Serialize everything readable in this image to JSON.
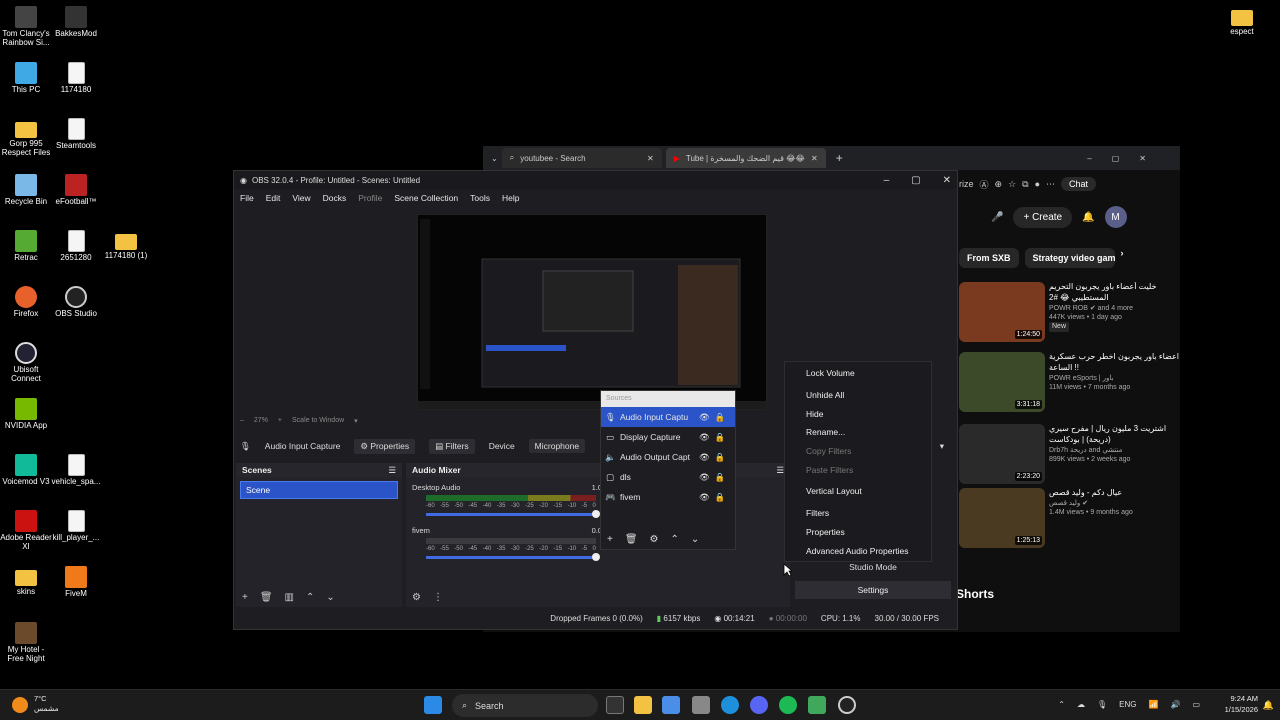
{
  "desktop": {
    "icons": [
      {
        "label": "Tom Clancy's Rainbow Si..."
      },
      {
        "label": "BakkesMod"
      },
      {
        "label": "This PC"
      },
      {
        "label": "1174180"
      },
      {
        "label": "Gorp 995 Respect Files"
      },
      {
        "label": "Steamtools"
      },
      {
        "label": "Recycle Bin"
      },
      {
        "label": "eFootball™"
      },
      {
        "label": "Retrac"
      },
      {
        "label": "2651280"
      },
      {
        "label": "1174180 (1)"
      },
      {
        "label": "Firefox"
      },
      {
        "label": "OBS Studio"
      },
      {
        "label": "Ubisoft Connect"
      },
      {
        "label": "NVIDIA App"
      },
      {
        "label": "Voicemod V3"
      },
      {
        "label": "vehicle_spa..."
      },
      {
        "label": "Adobe Reader XI"
      },
      {
        "label": "kill_player_..."
      },
      {
        "label": "skins"
      },
      {
        "label": "FiveM"
      },
      {
        "label": "My Hotel - Free Night"
      },
      {
        "label": "espect"
      }
    ]
  },
  "browser": {
    "tab1": "youtubee - Search",
    "tab2": "Tube | قيم الضحك والمسخرة 😂😂",
    "toolbar_partial": "rize",
    "chat_label": "Chat",
    "create_label": "Create",
    "avatar_letter": "M",
    "chips": [
      "From SXB",
      "Strategy video gam"
    ],
    "videos": [
      {
        "title": "خليت أعضاء باور يجربون التحريم المستطيبي 😂 #2",
        "channel": "POWR ROB ✔ and 4 more",
        "stats": "447K views • 1 day ago",
        "badge": "New",
        "duration": "1:24:50"
      },
      {
        "title": "اعضاء باور يجربون اخطر حرب عسكرية !! الساعة",
        "channel": "POWR eSports | باور",
        "stats": "11M views • 7 months ago",
        "badge": "",
        "duration": "3:31:18"
      },
      {
        "title": "اشتريت 3 مليون ريال | مفرح سيري (دريحة) | بودكاست",
        "channel": "Drb7h دريحة and منتشي",
        "stats": "899K views • 2 weeks ago",
        "badge": "",
        "duration": "2:23:20"
      },
      {
        "title": "عيال دكم - وليد قصص",
        "channel": "وليد قصص ✔",
        "stats": "1.4M views • 9 months ago",
        "badge": "",
        "duration": "1:25:13"
      }
    ],
    "shorts_label": "Shorts"
  },
  "obs": {
    "title": "OBS 32.0.4 - Profile: Untitled - Scenes: Untitled",
    "menu": [
      "File",
      "Edit",
      "View",
      "Docks",
      "Profile",
      "Scene Collection",
      "Tools",
      "Help"
    ],
    "zoom": "27%",
    "scale_label": "Scale to Window",
    "context_source": "Audio Input Capture",
    "properties_label": "Properties",
    "filters_label": "Filters",
    "device_label": "Device",
    "device_value": "Microphone",
    "scenes_header": "Scenes",
    "scenes": [
      "Scene"
    ],
    "mixer_header": "Audio Mixer",
    "channels": [
      {
        "name": "Desktop Audio",
        "db": "1.0"
      },
      {
        "name": "fivem",
        "db": "0.0"
      }
    ],
    "scale_ticks": [
      "-60",
      "-55",
      "-50",
      "-45",
      "-40",
      "-35",
      "-30",
      "-25",
      "-20",
      "-15",
      "-10",
      "-5",
      "0"
    ],
    "studio_mode_label": "Studio Mode",
    "settings_label": "Settings",
    "status": {
      "dropped": "Dropped Frames 0 (0.0%)",
      "kbps": "6157 kbps",
      "rec_time": "00:14:21",
      "stream_time": "00:00:00",
      "cpu": "CPU: 1.1%",
      "fps": "30.00 / 30.00 FPS"
    }
  },
  "sources_panel": {
    "header": "Sources",
    "items": [
      {
        "name": "Audio Input Captu",
        "icon": "mic-icon",
        "selected": true
      },
      {
        "name": "Display Capture",
        "icon": "monitor-icon",
        "selected": false
      },
      {
        "name": "Audio Output Capt",
        "icon": "speaker-icon",
        "selected": false
      },
      {
        "name": "dls",
        "icon": "window-icon",
        "selected": false
      },
      {
        "name": "fivem",
        "icon": "gamepad-icon",
        "selected": false
      }
    ]
  },
  "context_menu": {
    "items": [
      {
        "label": "Lock Volume",
        "enabled": true
      },
      {
        "label": "Unhide All",
        "enabled": true
      },
      {
        "label": "Hide",
        "enabled": true
      },
      {
        "label": "Rename...",
        "enabled": true
      },
      {
        "label": "Copy Filters",
        "enabled": false
      },
      {
        "label": "Paste Filters",
        "enabled": false
      },
      {
        "label": "Vertical Layout",
        "enabled": true
      },
      {
        "label": "Filters",
        "enabled": true
      },
      {
        "label": "Properties",
        "enabled": true
      },
      {
        "label": "Advanced Audio Properties",
        "enabled": true
      }
    ]
  },
  "taskbar": {
    "weather_temp": "7°C",
    "weather_text": "مشمس",
    "search_label": "Search",
    "lang": "ENG",
    "time": "9:24 AM",
    "date": "1/15/2026"
  }
}
